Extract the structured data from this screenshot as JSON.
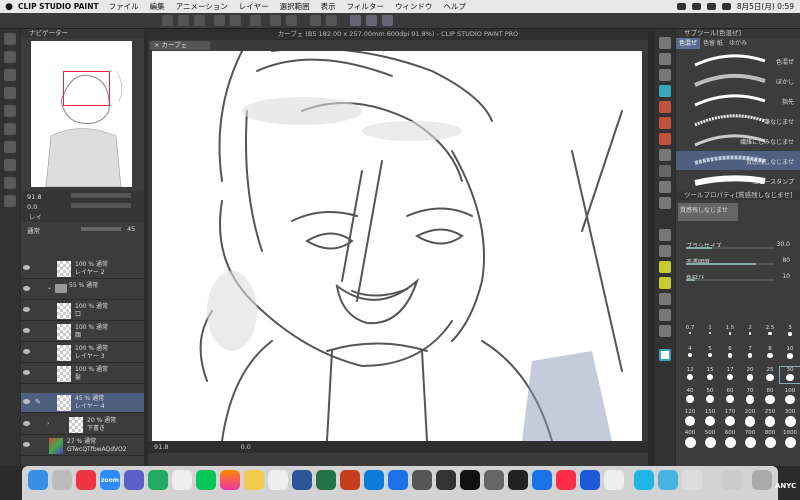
{
  "menubar": {
    "app_name": "CLIP STUDIO PAINT",
    "items": [
      "ファイル",
      "編集",
      "アニメーション",
      "レイヤー",
      "選択範囲",
      "表示",
      "フィルター",
      "ウィンドウ",
      "ヘルプ"
    ],
    "clock": "8月5日(月)  0:59"
  },
  "navigator": {
    "title": "ナビゲーター",
    "zoom": "91.8",
    "angle": "0.0"
  },
  "layer_panel": {
    "tab": "レイ",
    "blend_mode": "通常",
    "opacity": "45",
    "layers": [
      {
        "opacity": "100 %",
        "mode": "通常",
        "name": "レイヤー 2"
      },
      {
        "opacity": "55 %",
        "mode": "通常",
        "name": ""
      },
      {
        "opacity": "100 %",
        "mode": "通常",
        "name": "口"
      },
      {
        "opacity": "100 %",
        "mode": "通常",
        "name": "顔"
      },
      {
        "opacity": "100 %",
        "mode": "通常",
        "name": "レイヤー 3"
      },
      {
        "opacity": "100 %",
        "mode": "通常",
        "name": "髪"
      },
      {
        "opacity": "45 %",
        "mode": "通常",
        "name": "レイヤー 4",
        "selected": true
      },
      {
        "opacity": "20 %",
        "mode": "通常",
        "name": "下書き"
      },
      {
        "opacity": "27 %",
        "mode": "通常",
        "name": "GTwcQTfbwAQdVO2"
      }
    ]
  },
  "document": {
    "title": "カーブェ (B5 182.00 x 257.00mm 600dpi 91.8%)  - CLIP STUDIO PAINT PRO",
    "tab": "カーブェ",
    "zoom": "91.8",
    "angle": "0.0"
  },
  "subtool": {
    "title": "サブツール[色混ぜ]",
    "tabs": [
      "色混ぜ",
      "色留 紙",
      "ゆがみ"
    ],
    "brushes": [
      "色混ぜ",
      "ぼかし",
      "指先",
      "筆なじませ",
      "繊維にじみなじませ",
      "質感残しなじませ",
      "コピースタンプ"
    ],
    "selected_brush": "質感残しなじませ"
  },
  "tool_property": {
    "title": "ツールプロパティ[質感残しなじませ]",
    "subtitle": "質感残しなじませ",
    "props": [
      {
        "label": "ブラシサイズ",
        "value": "30.0",
        "level": 0.3
      },
      {
        "label": "不透明度",
        "value": "80",
        "level": 0.8
      },
      {
        "label": "色延び",
        "value": "10",
        "level": 0.1
      }
    ]
  },
  "brush_sizes": [
    "0.7",
    "1",
    "1.5",
    "2",
    "2.5",
    "3",
    "4",
    "5",
    "6",
    "7",
    "8",
    "10",
    "12",
    "15",
    "17",
    "20",
    "25",
    "30",
    "40",
    "50",
    "60",
    "70",
    "80",
    "100",
    "120",
    "150",
    "170",
    "200",
    "250",
    "300",
    "400",
    "500",
    "600",
    "700",
    "800",
    "1000"
  ],
  "dock": {
    "zoom_label": "zoom",
    "right_label": "ANYC"
  },
  "colors": {
    "accent": "#5a6d90",
    "selection": "#4f5f7f",
    "panel": "#3c3c3c"
  }
}
